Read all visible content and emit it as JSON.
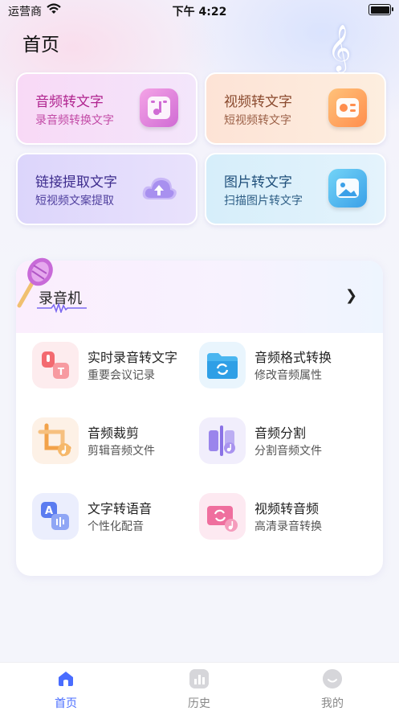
{
  "status_bar": {
    "carrier": "运营商",
    "time": "下午 4:22"
  },
  "page_title": "首页",
  "feature_cards": [
    {
      "title": "音频转文字",
      "subtitle": "录音频转换文字",
      "icon": "music-note-icon"
    },
    {
      "title": "视频转文字",
      "subtitle": "短视频转文字",
      "icon": "video-icon"
    },
    {
      "title": "链接提取文字",
      "subtitle": "短视频文案提取",
      "icon": "cloud-upload-icon"
    },
    {
      "title": "图片转文字",
      "subtitle": "扫描图片转文字",
      "icon": "image-icon"
    }
  ],
  "recorder": {
    "title": "录音机",
    "tools": [
      {
        "title": "实时录音转文字",
        "subtitle": "重要会议记录",
        "icon": "mic-text-icon"
      },
      {
        "title": "音频格式转换",
        "subtitle": "修改音频属性",
        "icon": "folder-convert-icon"
      },
      {
        "title": "音频裁剪",
        "subtitle": "剪辑音频文件",
        "icon": "crop-icon"
      },
      {
        "title": "音频分割",
        "subtitle": "分割音频文件",
        "icon": "split-icon"
      },
      {
        "title": "文字转语音",
        "subtitle": "个性化配音",
        "icon": "text-to-speech-icon"
      },
      {
        "title": "视频转音频",
        "subtitle": "高清录音转换",
        "icon": "video-to-audio-icon"
      }
    ]
  },
  "tab_bar": [
    {
      "label": "首页",
      "active": true
    },
    {
      "label": "历史",
      "active": false
    },
    {
      "label": "我的",
      "active": false
    }
  ],
  "colors": {
    "accent": "#4a6dff"
  }
}
